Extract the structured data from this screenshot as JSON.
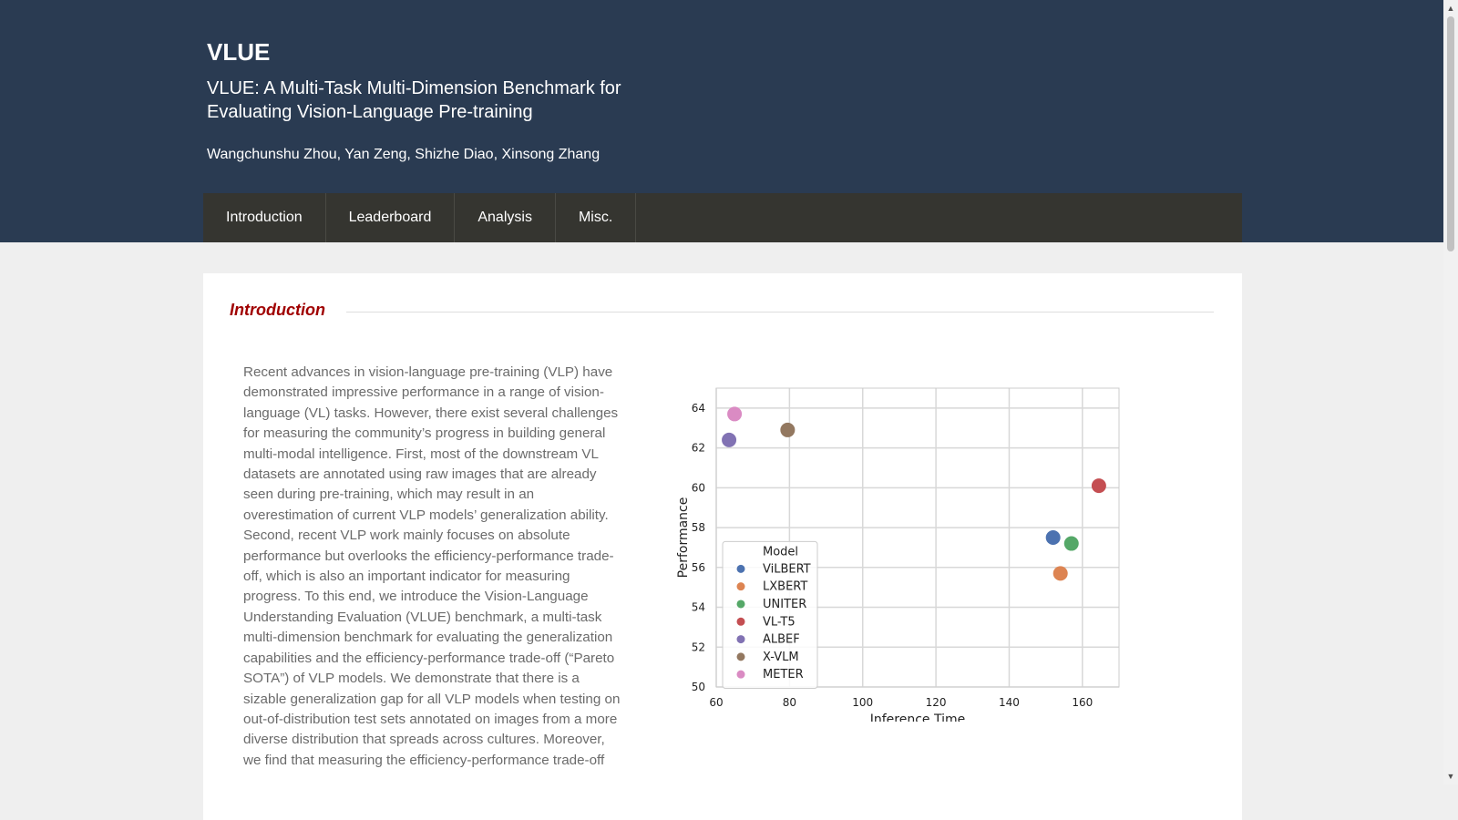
{
  "header": {
    "title": "VLUE",
    "subtitle": "VLUE: A Multi-Task Multi-Dimension Benchmark for Evaluating Vision-Language Pre-training",
    "authors": "Wangchunshu Zhou, Yan Zeng, Shizhe Diao, Xinsong Zhang",
    "background_color": "#2a3b52"
  },
  "nav": {
    "items": [
      {
        "label": "Introduction"
      },
      {
        "label": "Leaderboard"
      },
      {
        "label": "Analysis"
      },
      {
        "label": "Misc."
      }
    ]
  },
  "section": {
    "title": "Introduction",
    "title_color": "#a00000",
    "body": "Recent advances in vision-language pre-training (VLP) have demonstrated impressive performance in a range of vision-language (VL) tasks. However, there exist several challenges for measuring the community’s progress in building general multi-modal intelligence. First, most of the downstream VL datasets are annotated using raw images that are already seen during pre-training, which may result in an overestimation of current VLP models’ generalization ability. Second, recent VLP work mainly focuses on absolute performance but overlooks the efficiency-performance trade-off, which is also an important indicator for measuring progress. To this end, we introduce the Vision-Language Understanding Evaluation (VLUE) benchmark, a multi-task multi-dimension benchmark for evaluating the generalization capabilities and the efficiency-performance trade-off (“Pareto SOTA”) of VLP models. We demonstrate that there is a sizable generalization gap for all VLP models when testing on out-of-distribution test sets annotated on images from a more diverse distribution that spreads across cultures. Moreover, we find that measuring the efficiency-performance trade-off"
  },
  "chart_data": {
    "type": "scatter",
    "xlabel": "Inference Time",
    "ylabel": "Performance",
    "xlim": [
      60,
      170
    ],
    "ylim": [
      50,
      65
    ],
    "xticks": [
      60,
      80,
      100,
      120,
      140,
      160
    ],
    "yticks": [
      50,
      52,
      54,
      56,
      58,
      60,
      62,
      64
    ],
    "grid": true,
    "legend": {
      "title": "Model",
      "placement": "lower-left"
    },
    "series": [
      {
        "name": "ViLBERT",
        "color": "#4c72b0",
        "x": 152,
        "y": 57.5
      },
      {
        "name": "LXBERT",
        "color": "#dd8452",
        "x": 154,
        "y": 55.7
      },
      {
        "name": "UNITER",
        "color": "#55a868",
        "x": 157,
        "y": 57.2
      },
      {
        "name": "VL-T5",
        "color": "#c44e52",
        "x": 164.5,
        "y": 60.1
      },
      {
        "name": "ALBEF",
        "color": "#8172b3",
        "x": 63.5,
        "y": 62.4
      },
      {
        "name": "X-VLM",
        "color": "#937860",
        "x": 79.5,
        "y": 62.9
      },
      {
        "name": "METER",
        "color": "#da8bc3",
        "x": 65,
        "y": 63.7
      }
    ]
  }
}
